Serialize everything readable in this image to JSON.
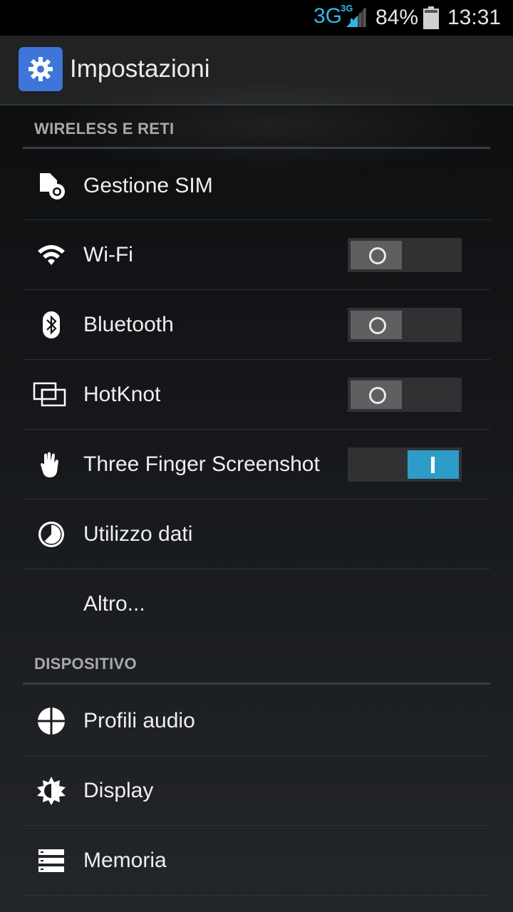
{
  "status_bar": {
    "network": "3G",
    "network_sup": "3G",
    "battery": "84%",
    "time": "13:31"
  },
  "action_bar": {
    "app_icon": "settings-gear-icon",
    "title": "Impostazioni"
  },
  "sections": {
    "wireless": {
      "header": "WIRELESS E RETI",
      "items": [
        {
          "label": "Gestione SIM",
          "icon": "sim-card-icon"
        },
        {
          "label": "Wi-Fi",
          "icon": "wifi-icon",
          "toggle": "off"
        },
        {
          "label": "Bluetooth",
          "icon": "bluetooth-icon",
          "toggle": "off"
        },
        {
          "label": "HotKnot",
          "icon": "hotknot-icon",
          "toggle": "off"
        },
        {
          "label": "Three Finger Screenshot",
          "icon": "three-finger-hand-icon",
          "toggle": "on"
        },
        {
          "label": "Utilizzo dati",
          "icon": "data-usage-icon"
        },
        {
          "label": "Altro..."
        }
      ]
    },
    "device": {
      "header": "DISPOSITIVO",
      "items": [
        {
          "label": "Profili audio",
          "icon": "audio-profiles-icon"
        },
        {
          "label": "Display",
          "icon": "display-brightness-icon"
        },
        {
          "label": "Memoria",
          "icon": "storage-icon"
        }
      ]
    }
  },
  "colors": {
    "accent": "#33b5e5",
    "toggle_on": "#2e9cc9",
    "app_icon_bg": "#3f74d9"
  }
}
